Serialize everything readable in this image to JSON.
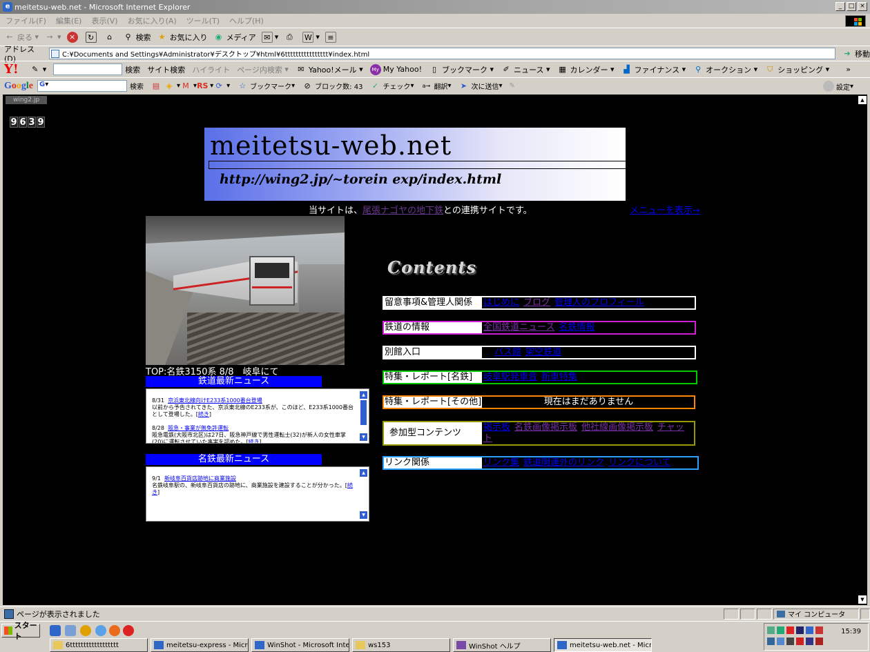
{
  "window": {
    "title": "meitetsu-web.net - Microsoft Internet Explorer"
  },
  "menubar": [
    "ファイル(F)",
    "編集(E)",
    "表示(V)",
    "お気に入り(A)",
    "ツール(T)",
    "ヘルプ(H)"
  ],
  "std_toolbar": {
    "back": "戻る",
    "search": "検索",
    "favorites": "お気に入り",
    "media": "メディア"
  },
  "address": {
    "label": "アドレス(D)",
    "url": "C:¥Documents and Settings¥Administrator¥デスクトップ¥html¥6tttttttttttttttt¥index.html",
    "go": "移動"
  },
  "yahoo_toolbar": {
    "search": "検索",
    "items": [
      "サイト検索",
      "ハイライト",
      "ページ内検索",
      "Yahoo!メール",
      "My Yahoo!",
      "ブックマーク",
      "ニュース",
      "カレンダー",
      "ファイナンス",
      "オークション",
      "ショッピング"
    ],
    "more": "»"
  },
  "google_toolbar": {
    "logo": "Google",
    "search": "検索",
    "items": [
      "ブックマーク",
      "ブロック数: 43",
      "チェック",
      "翻訳",
      "次に送信"
    ],
    "settings": "設定"
  },
  "page": {
    "wing_tag": "wing2.jp",
    "counter": [
      "9",
      "6",
      "3",
      "9"
    ],
    "logo_title": "meitetsu-web.net",
    "logo_url": "http://wing2.jp/~torein exp/index.html",
    "tagline_before": "当サイトは、",
    "tagline_link": "尾張ナゴヤの地下鉄",
    "tagline_after": "との連携サイトです。",
    "menu_link": "メニューを表示→",
    "photo_caption": "TOP:名鉄3150系 8/8　岐阜にて",
    "contents_title": "Contents",
    "railway_news": {
      "header": "鉄道最新ニュース",
      "items": [
        {
          "date": "8/31",
          "title": "京浜東北線向けE233系1000番台登場",
          "body": "以前から予告されてきた、京浜東北線のE233系が、このほど、E233系1000番台として登場した。",
          "more": "続き"
        },
        {
          "date": "8/28",
          "title": "阪急・事業が無免許運転",
          "body": "阪急電鉄(大阪市北区)は27日、阪急神戸線で男性運転士(32)が新人の女性車掌(20)に運転させていた事実を認めた。",
          "more": "続き"
        }
      ]
    },
    "meitetsu_news": {
      "header": "名鉄最新ニュース",
      "items": [
        {
          "date": "9/1",
          "title": "新岐阜百貨店跡地に商業施設",
          "body": "名鉄岐阜駅の、新岐阜百貨店の跡地に、商業施設を建設することが分かった。",
          "more": "続き"
        }
      ]
    },
    "contents": [
      {
        "label": "留意事項&管理人関係",
        "border": "#ffffff",
        "links": [
          {
            "text": "はじめに",
            "color": "#0000ee"
          },
          {
            "text": "ブログ",
            "color": "#7b2fa8"
          },
          {
            "text": "管理人のプロフィール",
            "color": "#0000ee"
          }
        ]
      },
      {
        "label": "鉄道の情報",
        "border": "#d020d0",
        "links": [
          {
            "text": "全国鉄道ニュース",
            "color": "#7b2fa8"
          },
          {
            "text": "名鉄情報",
            "color": "#0000ee"
          }
        ]
      },
      {
        "label": "別館入口",
        "border": "#ffffff",
        "links": [
          {
            "text": "バス館",
            "color": "#0000ee"
          },
          {
            "text": "架空鉄道",
            "color": "#0000ee"
          }
        ]
      },
      {
        "label": "特集・レポート[名鉄]",
        "border": "#00cc00",
        "links": [
          {
            "text": "岐阜駅発車音",
            "color": "#0000ee"
          },
          {
            "text": "新車特集",
            "color": "#0000ee"
          }
        ]
      },
      {
        "label": "特集・レポート[その他]",
        "border": "#ff8800",
        "plain": "現在はまだありません"
      },
      {
        "label": "参加型コンテンツ",
        "border": "#999900",
        "links": [
          {
            "text": "掲示板",
            "color": "#0000ee"
          },
          {
            "text": "名鉄画像掲示板",
            "color": "#7b2fa8"
          },
          {
            "text": "他社線画像掲示板",
            "color": "#7b2fa8"
          },
          {
            "text": "チャット",
            "color": "#7b2fa8"
          }
        ]
      },
      {
        "label": "リンク関係",
        "border": "#2aa0ff",
        "links": [
          {
            "text": "リンク集",
            "color": "#0000ee"
          },
          {
            "text": "鉄道関連外のリンク",
            "color": "#0000ee"
          },
          {
            "text": "リンクについて",
            "color": "#0000ee"
          }
        ]
      }
    ]
  },
  "statusbar": {
    "text": "ページが表示されました",
    "zone": "マイ コンピュータ"
  },
  "taskbar": {
    "start": "スタート",
    "tasks": [
      "6tttttttttttttttttt",
      "meitetsu-express - Micros...",
      "WinShot - Microsoft Inter...",
      "ws153",
      "WinShot ヘルプ",
      "meitetsu-web.net - Micros..."
    ],
    "clock": "15:39"
  }
}
